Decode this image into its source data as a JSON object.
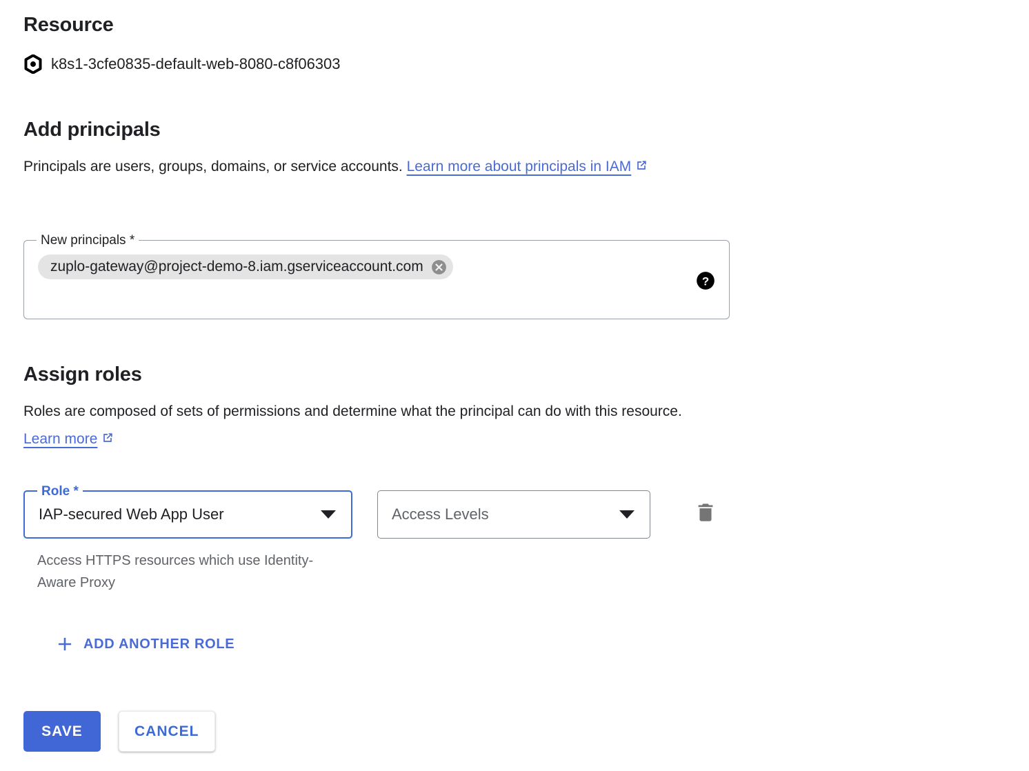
{
  "resource": {
    "heading": "Resource",
    "icon": "hexagon-resource-icon",
    "name": "k8s1-3cfe0835-default-web-8080-c8f06303"
  },
  "add_principals": {
    "heading": "Add principals",
    "description_before_link": "Principals are users, groups, domains, or service accounts. ",
    "link_text": "Learn more about principals in IAM",
    "link_icon": "open-in-new-icon",
    "field": {
      "label": "New principals *",
      "chips": [
        {
          "label": "zuplo-gateway@project-demo-8.iam.gserviceaccount.com",
          "remove_icon": "close-circle-icon"
        }
      ],
      "help_icon": "help-circle-icon"
    }
  },
  "assign_roles": {
    "heading": "Assign roles",
    "description_before_link": "Roles are composed of sets of permissions and determine what the principal can do with this resource. ",
    "link_text": "Learn more",
    "link_icon": "open-in-new-icon",
    "role_field": {
      "label": "Role *",
      "value": "IAP-secured Web App User",
      "arrow_icon": "chevron-down-icon",
      "helper_text": "Access HTTPS resources which use Identity-Aware Proxy"
    },
    "access_levels_field": {
      "placeholder": "Access Levels",
      "value": "",
      "arrow_icon": "chevron-down-icon"
    },
    "delete_icon": "trash-icon",
    "add_another_role": {
      "label": "ADD ANOTHER ROLE",
      "icon": "plus-icon"
    }
  },
  "footer": {
    "save_label": "SAVE",
    "cancel_label": "CANCEL"
  },
  "colors": {
    "accent_blue": "#4166d5",
    "link_blue": "#4a6ad6",
    "focus_blue": "#3d6ad6",
    "text_primary": "#202124",
    "text_secondary": "#5f6368",
    "chip_bg": "#e4e4e4",
    "border_gray": "#80868b"
  }
}
